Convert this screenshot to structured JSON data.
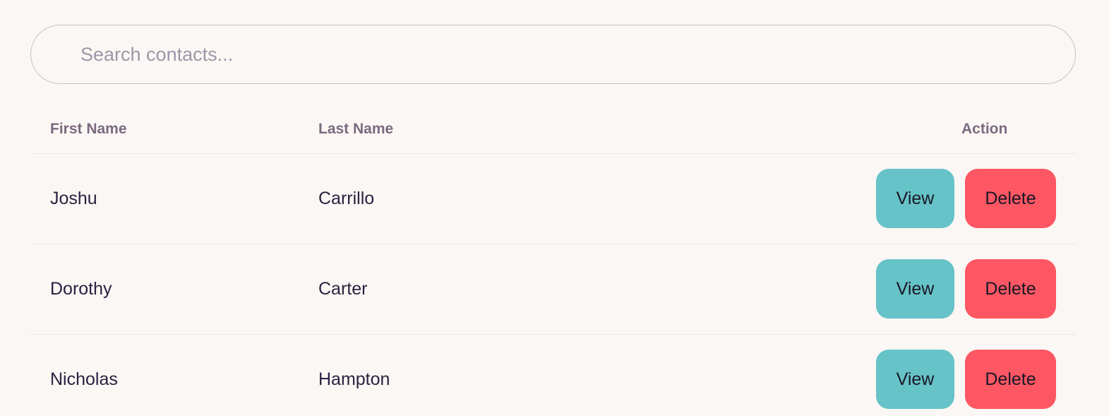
{
  "search": {
    "placeholder": "Search contacts...",
    "value": ""
  },
  "table": {
    "headers": {
      "first_name": "First Name",
      "last_name": "Last Name",
      "action": "Action"
    },
    "rows": [
      {
        "first_name": "Joshu",
        "last_name": "Carrillo",
        "view_label": "View",
        "delete_label": "Delete"
      },
      {
        "first_name": "Dorothy",
        "last_name": "Carter",
        "view_label": "View",
        "delete_label": "Delete"
      },
      {
        "first_name": "Nicholas",
        "last_name": "Hampton",
        "view_label": "View",
        "delete_label": "Delete"
      }
    ]
  },
  "colors": {
    "background": "#fbf7f4",
    "view_button": "#66c3c7",
    "delete_button": "#fc5763",
    "header_text": "#7a6a80",
    "body_text": "#2b2140",
    "placeholder_text": "#9a98a8"
  }
}
